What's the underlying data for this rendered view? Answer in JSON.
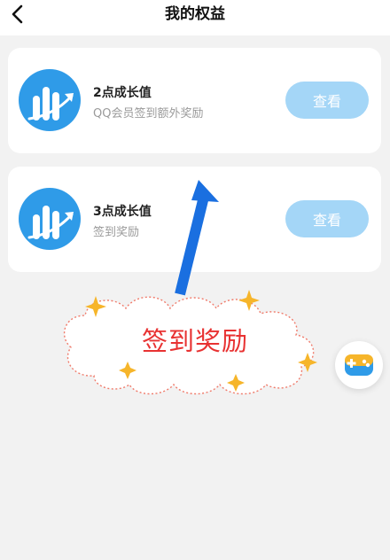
{
  "header": {
    "title": "我的权益",
    "back_icon": "chevron-left-icon"
  },
  "rewards": [
    {
      "title": "2点成长值",
      "subtitle": "QQ会员签到额外奖励",
      "button_label": "查看",
      "icon": "growth-chart-icon"
    },
    {
      "title": "3点成长值",
      "subtitle": "签到奖励",
      "button_label": "查看",
      "icon": "growth-chart-icon"
    }
  ],
  "annotation": {
    "text": "签到奖励",
    "arrow_color": "#1a6fe0",
    "text_color": "#e83232"
  },
  "floating": {
    "icon": "game-controller-icon"
  },
  "colors": {
    "accent": "#a4d6f7",
    "icon_blue": "#2f9be8",
    "background": "#f2f2f2"
  }
}
